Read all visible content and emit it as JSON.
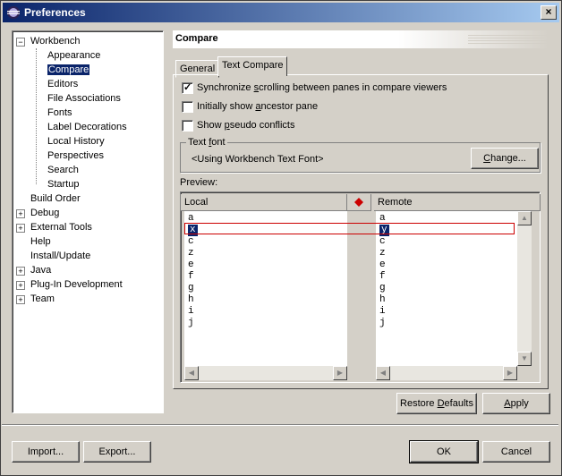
{
  "window": {
    "title": "Preferences",
    "close": "×"
  },
  "tree": {
    "items": [
      {
        "label": "Workbench",
        "expander": "−"
      },
      {
        "label": "Appearance"
      },
      {
        "label": "Compare",
        "selected": true
      },
      {
        "label": "Editors"
      },
      {
        "label": "File Associations"
      },
      {
        "label": "Fonts"
      },
      {
        "label": "Label Decorations"
      },
      {
        "label": "Local History"
      },
      {
        "label": "Perspectives"
      },
      {
        "label": "Search"
      },
      {
        "label": "Startup"
      },
      {
        "label": "Build Order"
      },
      {
        "label": "Debug",
        "expander": "+"
      },
      {
        "label": "External Tools",
        "expander": "+"
      },
      {
        "label": "Help"
      },
      {
        "label": "Install/Update"
      },
      {
        "label": "Java",
        "expander": "+"
      },
      {
        "label": "Plug-In Development",
        "expander": "+"
      },
      {
        "label": "Team",
        "expander": "+"
      }
    ]
  },
  "page": {
    "title": "Compare"
  },
  "tabs": {
    "general": "General",
    "text_compare": "Text Compare"
  },
  "options": {
    "sync_pre": "Synchronize ",
    "sync_u": "s",
    "sync_post": "crolling between panes in compare viewers",
    "ancestor_pre": "Initially show ",
    "ancestor_u": "a",
    "ancestor_post": "ncestor pane",
    "pseudo_pre": "Show ",
    "pseudo_u": "p",
    "pseudo_post": "seudo conflicts",
    "sync_checked": true,
    "ancestor_checked": false,
    "pseudo_checked": false
  },
  "text_font": {
    "group_pre": "Text ",
    "group_u": "f",
    "group_post": "ont",
    "value": "<Using Workbench Text Font>",
    "change_u": "C",
    "change_post": "hange..."
  },
  "preview": {
    "label": "Preview:",
    "local_header": "Local",
    "remote_header": "Remote",
    "local_lines": [
      "a",
      "x",
      "c",
      "z",
      "e",
      "f",
      "g",
      "h",
      "i",
      "j"
    ],
    "remote_lines": [
      "a",
      "y",
      "c",
      "z",
      "e",
      "f",
      "g",
      "h",
      "i",
      "j"
    ],
    "diff_color": "#cc0000"
  },
  "buttons": {
    "restore_pre": "Restore ",
    "restore_u": "D",
    "restore_post": "efaults",
    "apply_u": "A",
    "apply_post": "pply",
    "import": "Import...",
    "export": "Export...",
    "ok": "OK",
    "cancel": "Cancel"
  }
}
